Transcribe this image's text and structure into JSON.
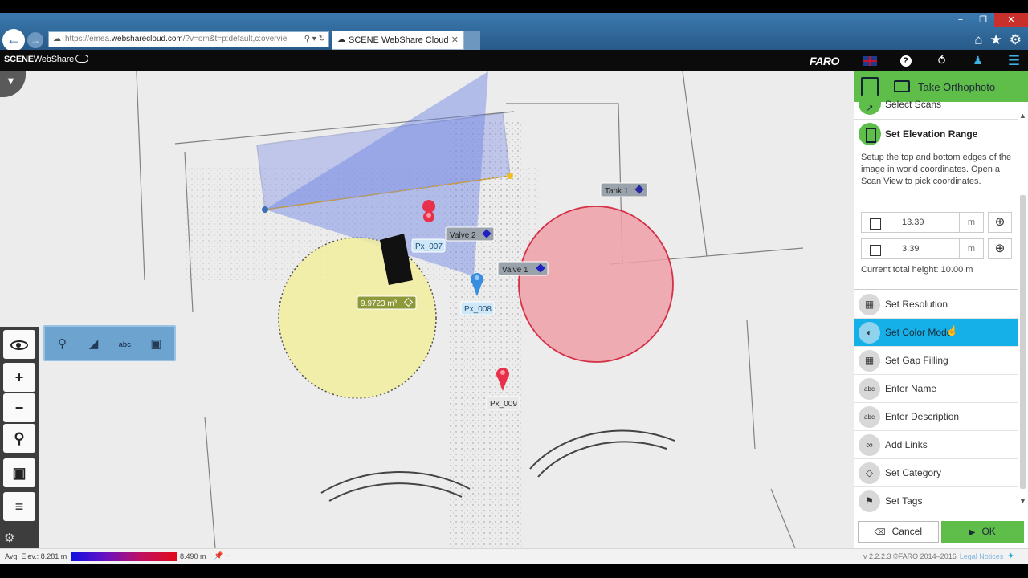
{
  "browser": {
    "url_prefix": "https://emea.",
    "url_host": "websharecloud.com",
    "url_suffix": "/?v=om&t=p:default,c:overvie",
    "tab_title": "SCENE WebShare Cloud",
    "controls": {
      "minimize": "−",
      "restore": "❐",
      "close": "✕"
    }
  },
  "app": {
    "logo_bold": "SCENE",
    "logo_rest": "WebShare",
    "brand": "FARO"
  },
  "map": {
    "labels": {
      "tank1": "Tank 1",
      "valve2": "Valve 2",
      "valve1": "Valve 1",
      "px007": "Px_007",
      "px008": "Px_008",
      "px009": "Px_009",
      "volume": "9.9723 m³"
    },
    "colors": {
      "pin_red": "#e8304a",
      "pin_blue": "#3a8ee0",
      "yellow_zone": "#f2ef9e",
      "red_zone": "#f0a0a8",
      "blue_view": "#6c82e6"
    }
  },
  "panel": {
    "header_title": "Take Orthophoto",
    "partial_item": "Select Scans",
    "elevation": {
      "title": "Set Elevation Range",
      "description": "Setup the top and bottom edges of the image in world coordinates. Open a Scan View to pick coordinates.",
      "top_value": "13.39",
      "bottom_value": "3.39",
      "unit": "m",
      "total": "Current total height: 10.00 m"
    },
    "items": [
      {
        "label": "Set Resolution",
        "icon": "grid-icon"
      },
      {
        "label": "Set Color Mode",
        "icon": "color-mode-icon"
      },
      {
        "label": "Set Gap Filling",
        "icon": "gap-filling-icon"
      },
      {
        "label": "Enter Name",
        "icon": "abc-icon"
      },
      {
        "label": "Enter Description",
        "icon": "abc-icon"
      },
      {
        "label": "Add Links",
        "icon": "link-icon"
      },
      {
        "label": "Set Category",
        "icon": "diamond-icon"
      },
      {
        "label": "Set Tags",
        "icon": "tag-icon"
      }
    ],
    "cancel_label": "Cancel",
    "ok_label": "OK"
  },
  "status": {
    "elev_label": "Avg. Elev.: 8.281 m",
    "elev_max": "8.490 m",
    "version": "v 2.2.2.3  ©FARO 2014–2016",
    "legal": "Legal Notices"
  }
}
